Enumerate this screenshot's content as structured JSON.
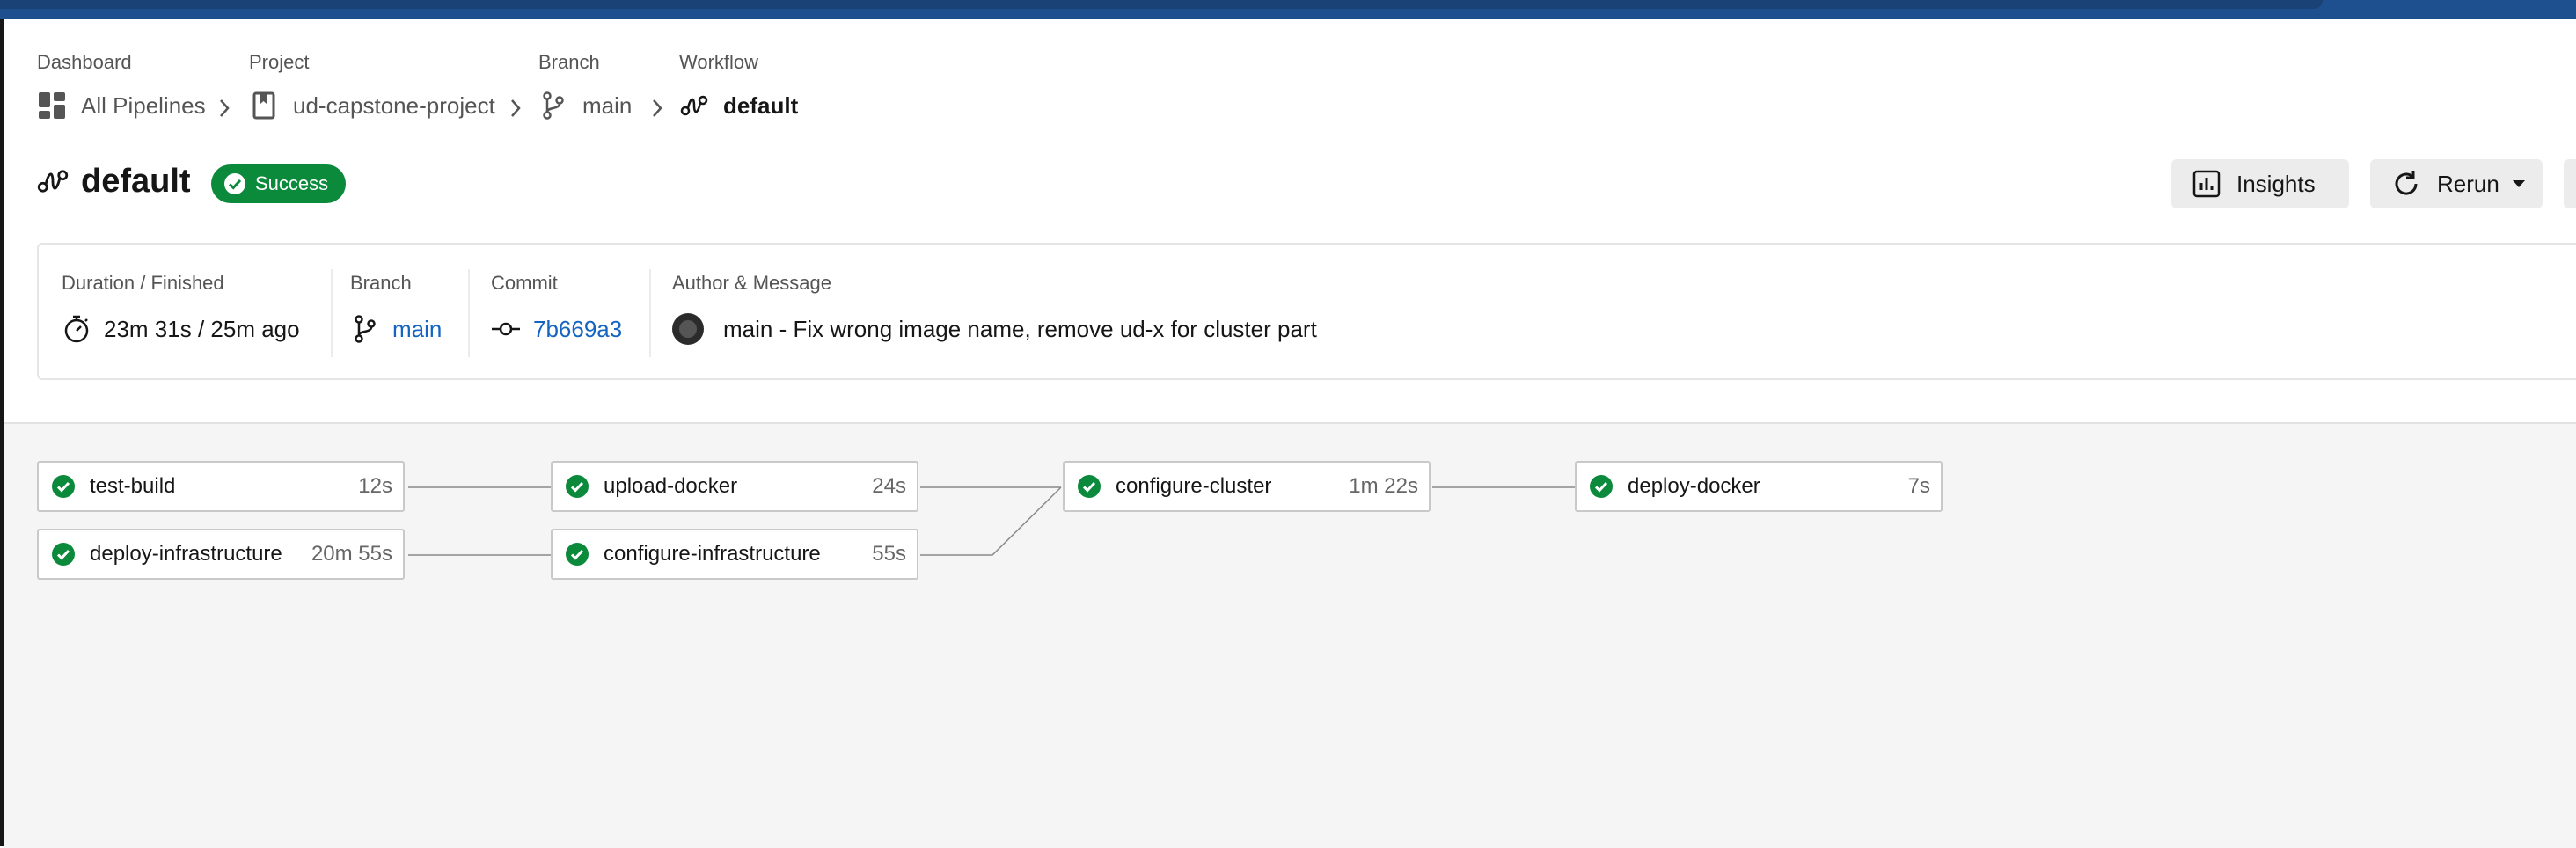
{
  "breadcrumb": {
    "dashboard": {
      "label": "Dashboard",
      "value": "All Pipelines"
    },
    "project": {
      "label": "Project",
      "value": "ud-capstone-project"
    },
    "branch": {
      "label": "Branch",
      "value": "main"
    },
    "workflow": {
      "label": "Workflow",
      "value": "default"
    }
  },
  "header": {
    "title": "default",
    "status": "Success",
    "insights_label": "Insights",
    "rerun_label": "Rerun"
  },
  "summary": {
    "duration_label": "Duration / Finished",
    "duration_value": "23m 31s / 25m ago",
    "branch_label": "Branch",
    "branch_value": "main",
    "commit_label": "Commit",
    "commit_value": "7b669a3",
    "author_label": "Author & Message",
    "message": "main - Fix wrong image name, remove ud-x for cluster part"
  },
  "jobs": [
    {
      "name": "test-build",
      "duration": "12s",
      "status": "success"
    },
    {
      "name": "deploy-infrastructure",
      "duration": "20m 55s",
      "status": "success"
    },
    {
      "name": "upload-docker",
      "duration": "24s",
      "status": "success"
    },
    {
      "name": "configure-infrastructure",
      "duration": "55s",
      "status": "success"
    },
    {
      "name": "configure-cluster",
      "duration": "1m 22s",
      "status": "success"
    },
    {
      "name": "deploy-docker",
      "duration": "7s",
      "status": "success"
    }
  ],
  "colors": {
    "success": "#0b8a3b",
    "link": "#1565c0",
    "topbar": "#1e4f8f"
  }
}
